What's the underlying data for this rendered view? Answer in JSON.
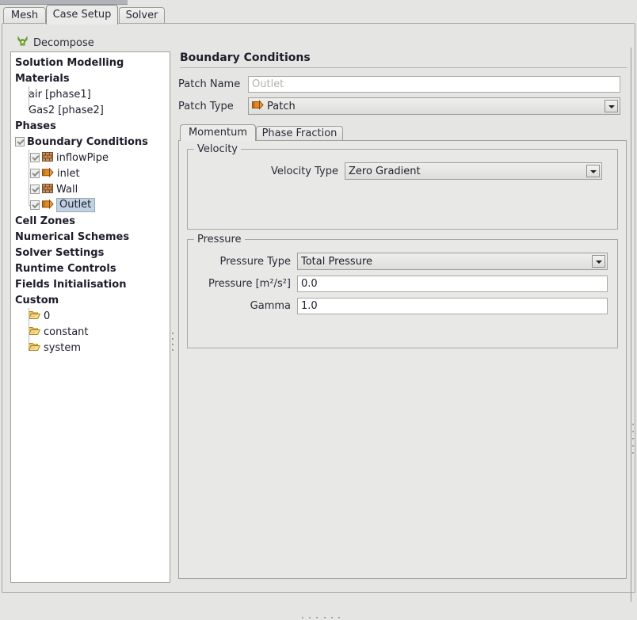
{
  "window": {
    "tabs": [
      {
        "label": "Mesh",
        "active": false
      },
      {
        "label": "Case Setup",
        "active": true
      },
      {
        "label": "Solver",
        "active": false
      }
    ]
  },
  "toolbar": {
    "decompose_label": "Decompose",
    "decompose_icon": "decompose-green-icon"
  },
  "tree": {
    "items": [
      {
        "label": "Solution Modelling",
        "bold": true,
        "indent": 0,
        "icon": "none",
        "checkbox": false,
        "selected": false
      },
      {
        "label": "Materials",
        "bold": true,
        "indent": 0,
        "icon": "none",
        "checkbox": false,
        "selected": false
      },
      {
        "label": "air [phase1]",
        "bold": false,
        "indent": 1,
        "icon": "none",
        "checkbox": false,
        "selected": false
      },
      {
        "label": "Gas2 [phase2]",
        "bold": false,
        "indent": 1,
        "icon": "none",
        "checkbox": false,
        "selected": false
      },
      {
        "label": "Phases",
        "bold": true,
        "indent": 0,
        "icon": "none",
        "checkbox": false,
        "selected": false
      },
      {
        "label": "Boundary Conditions",
        "bold": true,
        "indent": 0,
        "icon": "none",
        "checkbox": true,
        "selected": false
      },
      {
        "label": "inflowPipe",
        "bold": false,
        "indent": 1,
        "icon": "wall",
        "checkbox": true,
        "selected": false
      },
      {
        "label": "inlet",
        "bold": false,
        "indent": 1,
        "icon": "patch",
        "checkbox": true,
        "selected": false
      },
      {
        "label": "Wall",
        "bold": false,
        "indent": 1,
        "icon": "wall",
        "checkbox": true,
        "selected": false
      },
      {
        "label": "Outlet",
        "bold": false,
        "indent": 1,
        "icon": "patch",
        "checkbox": true,
        "selected": true
      },
      {
        "label": "Cell Zones",
        "bold": true,
        "indent": 0,
        "icon": "none",
        "checkbox": false,
        "selected": false
      },
      {
        "label": "Numerical Schemes",
        "bold": true,
        "indent": 0,
        "icon": "none",
        "checkbox": false,
        "selected": false
      },
      {
        "label": "Solver Settings",
        "bold": true,
        "indent": 0,
        "icon": "none",
        "checkbox": false,
        "selected": false
      },
      {
        "label": "Runtime Controls",
        "bold": true,
        "indent": 0,
        "icon": "none",
        "checkbox": false,
        "selected": false
      },
      {
        "label": "Fields Initialisation",
        "bold": true,
        "indent": 0,
        "icon": "none",
        "checkbox": false,
        "selected": false
      },
      {
        "label": "Custom",
        "bold": true,
        "indent": 0,
        "icon": "none",
        "checkbox": false,
        "selected": false
      },
      {
        "label": "0",
        "bold": false,
        "indent": 1,
        "icon": "folder",
        "checkbox": false,
        "selected": false
      },
      {
        "label": "constant",
        "bold": false,
        "indent": 1,
        "icon": "folder",
        "checkbox": false,
        "selected": false
      },
      {
        "label": "system",
        "bold": false,
        "indent": 1,
        "icon": "folder",
        "checkbox": false,
        "selected": false
      }
    ]
  },
  "panel": {
    "title": "Boundary Conditions",
    "patch_name_label": "Patch Name",
    "patch_name_value": "",
    "patch_name_placeholder": "Outlet",
    "patch_type_label": "Patch Type",
    "patch_type_value": "Patch",
    "patch_type_icon": "patch-icon",
    "tabs": [
      {
        "label": "Momentum",
        "active": true
      },
      {
        "label": "Phase Fraction",
        "active": false
      }
    ],
    "velocity": {
      "group_title": "Velocity",
      "type_label": "Velocity Type",
      "type_value": "Zero Gradient"
    },
    "pressure": {
      "group_title": "Pressure",
      "type_label": "Pressure Type",
      "type_value": "Total Pressure",
      "pressure_label": "Pressure [m²/s²]",
      "pressure_value": "0.0",
      "gamma_label": "Gamma",
      "gamma_value": "1.0"
    }
  },
  "colors": {
    "window_bg": "#e5e5e3",
    "panel_bg": "#e8e8e6",
    "tree_bg": "#ffffff",
    "selection": "#c0d1e2",
    "patch_icon": "#e08a1e",
    "wall_icon": "#a3683c",
    "folder_icon": "#f2c14e",
    "decompose_icon": "#8cc63f",
    "border": "#a0a09c",
    "text": "#1d1d2b"
  }
}
